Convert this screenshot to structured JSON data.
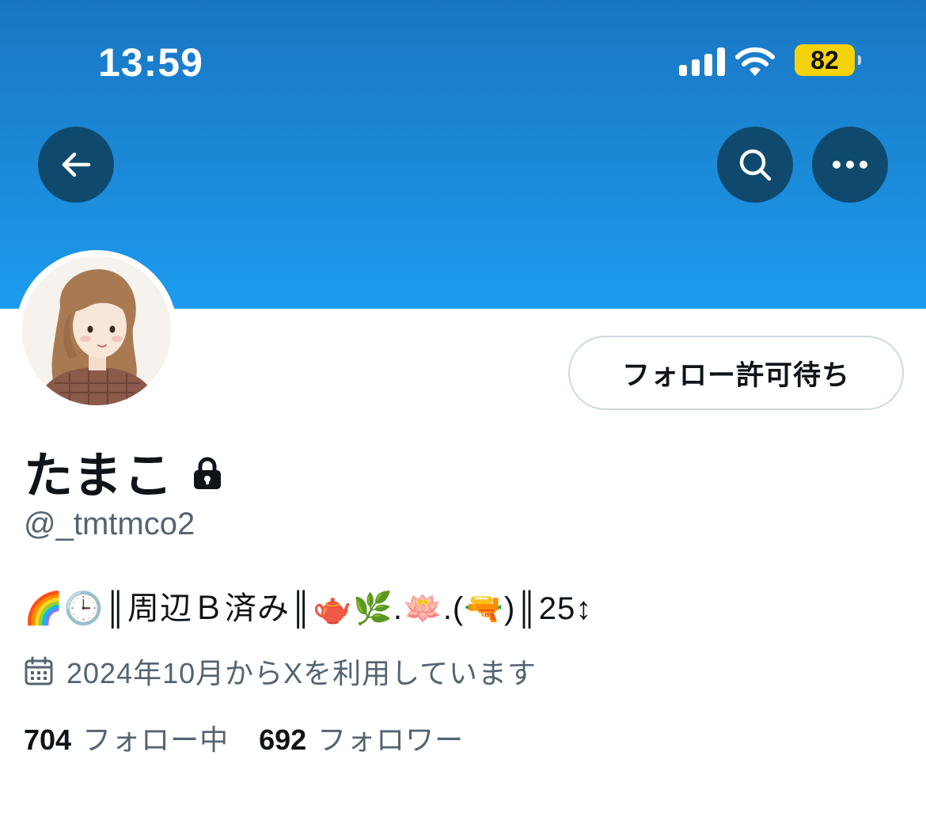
{
  "status_bar": {
    "time": "13:59",
    "battery": "82"
  },
  "profile": {
    "display_name": "たまこ",
    "handle": "@_tmtmco2",
    "follow_button_label": "フォロー許可待ち",
    "bio": "🌈🕒║周辺Ｂ済み║🫖🌿.🪷.(🔫)║25↕",
    "joined": "2024年10月からXを利用しています",
    "following_count": "704",
    "following_label": "フォロー中",
    "followers_count": "692",
    "followers_label": "フォロワー"
  },
  "icons": {
    "back": "arrow-left-icon",
    "search": "search-icon",
    "more": "more-icon",
    "lock": "lock-icon",
    "calendar": "calendar-icon"
  },
  "colors": {
    "banner_top": "#1a76c4",
    "banner_bottom": "#1d9bf0",
    "nav_button": "#0f4a6e",
    "battery": "#f5d30c",
    "secondary_text": "#536471"
  }
}
